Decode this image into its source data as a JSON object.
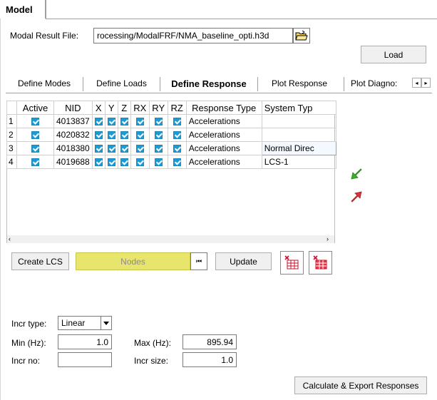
{
  "panel_tab": "Model",
  "modal_file": {
    "label": "Modal Result File:",
    "value": "rocessing/ModalFRF/NMA_baseline_opti.h3d"
  },
  "load_button": "Load",
  "tabs": [
    {
      "label": "Define Modes"
    },
    {
      "label": "Define Loads"
    },
    {
      "label": "Define Response"
    },
    {
      "label": "Plot Response"
    },
    {
      "label": "Plot Diagno:"
    }
  ],
  "grid": {
    "headers": [
      "",
      "Active",
      "NID",
      "X",
      "Y",
      "Z",
      "RX",
      "RY",
      "RZ",
      "Response Type",
      "System Typ"
    ],
    "rows": [
      {
        "index": "1",
        "nid": "4013837",
        "response_type": "Accelerations",
        "system_type": ""
      },
      {
        "index": "2",
        "nid": "4020832",
        "response_type": "Accelerations",
        "system_type": ""
      },
      {
        "index": "3",
        "nid": "4018380",
        "response_type": "Accelerations",
        "system_type": "Normal Direc"
      },
      {
        "index": "4",
        "nid": "4019688",
        "response_type": "Accelerations",
        "system_type": "LCS-1"
      }
    ]
  },
  "toolbar": {
    "create_lcs": "Create LCS",
    "nodes": "Nodes",
    "update": "Update"
  },
  "incr": {
    "type_label": "Incr type:",
    "type_value": "Linear",
    "min_label": "Min (Hz):",
    "min_value": "1.0",
    "max_label": "Max (Hz):",
    "max_value": "895.94",
    "no_label": "Incr no:",
    "no_value": "",
    "size_label": "Incr size:",
    "size_value": "1.0"
  },
  "calc_button": "Calculate & Export Responses",
  "colors": {
    "checkbox": "#1c9ad6",
    "nodes_bg": "#e8e56c",
    "arrow_green": "#3cae2a",
    "arrow_red": "#d8343b"
  }
}
